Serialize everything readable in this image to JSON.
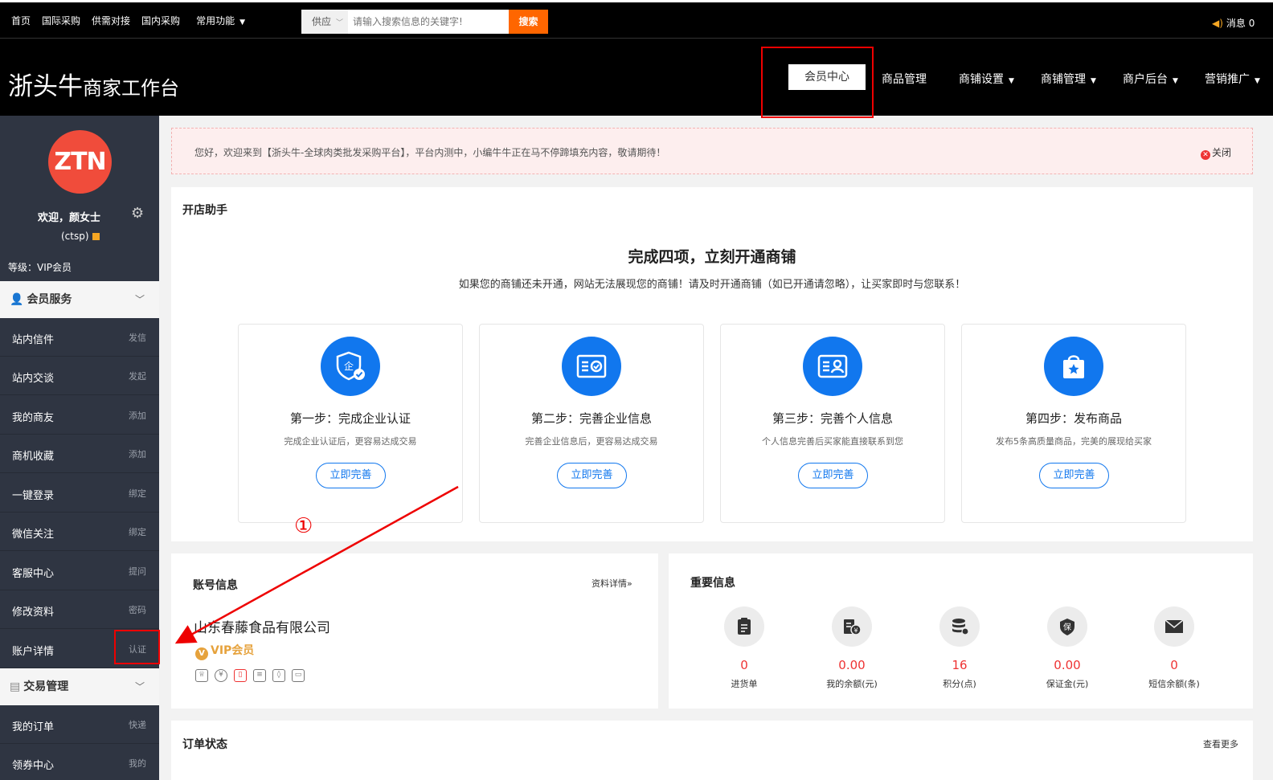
{
  "topbar": {
    "nav": [
      "首页",
      "国际采购",
      "供需对接",
      "国内采购",
      "常用功能"
    ],
    "search_select": "供应",
    "search_placeholder": "请输入搜索信息的关键字!",
    "search_button": "搜索",
    "messages_label": "消息 0"
  },
  "header": {
    "brand_main": "浙头牛",
    "brand_sub": "商家工作台",
    "nav": [
      "会员中心",
      "商品管理",
      "商铺设置",
      "商铺管理",
      "商户后台",
      "营销推广"
    ]
  },
  "sidebar": {
    "avatar_text": "ZTN",
    "welcome": "欢迎，颜女士",
    "account": "(ctsp)",
    "level": "等级：VIP会员",
    "section_member": "会员服务",
    "items": [
      {
        "label": "站内信件",
        "action": "发信"
      },
      {
        "label": "站内交谈",
        "action": "发起"
      },
      {
        "label": "我的商友",
        "action": "添加"
      },
      {
        "label": "商机收藏",
        "action": "添加"
      },
      {
        "label": "一键登录",
        "action": "绑定"
      },
      {
        "label": "微信关注",
        "action": "绑定"
      },
      {
        "label": "客服中心",
        "action": "提问"
      },
      {
        "label": "修改资料",
        "action": "密码"
      },
      {
        "label": "账户详情",
        "action": "认证"
      }
    ],
    "section_trade": "交易管理",
    "trade_items": [
      {
        "label": "我的订单",
        "action": "快递"
      },
      {
        "label": "领券中心",
        "action": "我的"
      }
    ]
  },
  "notice": {
    "text": "您好，欢迎来到【浙头牛-全球肉类批发采购平台】，平台内测中，小编牛牛正在马不停蹄填充内容，敬请期待！",
    "close_label": "关闭"
  },
  "helper": {
    "title": "开店助手",
    "headline": "完成四项，立刻开通商铺",
    "subline": "如果您的商铺还未开通，网站无法展现您的商铺！请及时开通商铺（如已开通请忽略），让买家即时与您联系！",
    "steps": [
      {
        "title": "第一步：完成企业认证",
        "desc": "完成企业认证后，更容易达成交易",
        "button": "立即完善",
        "icon": "enterprise-shield-icon"
      },
      {
        "title": "第二步：完善企业信息",
        "desc": "完善企业信息后，更容易达成交易",
        "button": "立即完善",
        "icon": "license-card-icon"
      },
      {
        "title": "第三步：完善个人信息",
        "desc": "个人信息完善后买家能直接联系到您",
        "button": "立即完善",
        "icon": "id-card-icon"
      },
      {
        "title": "第四步：发布商品",
        "desc": "发布5条高质量商品，完美的展现给买家",
        "button": "立即完善",
        "icon": "shopping-bag-icon"
      }
    ]
  },
  "account": {
    "title": "账号信息",
    "details_link": "资料详情»",
    "company": "山东春藤食品有限公司",
    "vip": "VIP会员",
    "vip_badge": "V"
  },
  "important": {
    "title": "重要信息",
    "stats": [
      {
        "value": "0",
        "label": "进货单",
        "icon": "clipboard-icon"
      },
      {
        "value": "0.00",
        "label": "我的余额(元)",
        "icon": "balance-icon"
      },
      {
        "value": "16",
        "label": "积分(点)",
        "icon": "coins-icon"
      },
      {
        "value": "0.00",
        "label": "保证金(元)",
        "icon": "deposit-shield-icon"
      },
      {
        "value": "0",
        "label": "短信余额(条)",
        "icon": "envelope-icon"
      }
    ]
  },
  "orders": {
    "title": "订单状态",
    "more": "查看更多"
  },
  "annotation": {
    "step_number": "①"
  },
  "colors": {
    "accent_blue": "#1177ee",
    "alert_red": "#ee0000",
    "search_orange": "#ff6600",
    "avatar_red": "#f04c3b",
    "sidebar_bg": "#2f3542"
  }
}
